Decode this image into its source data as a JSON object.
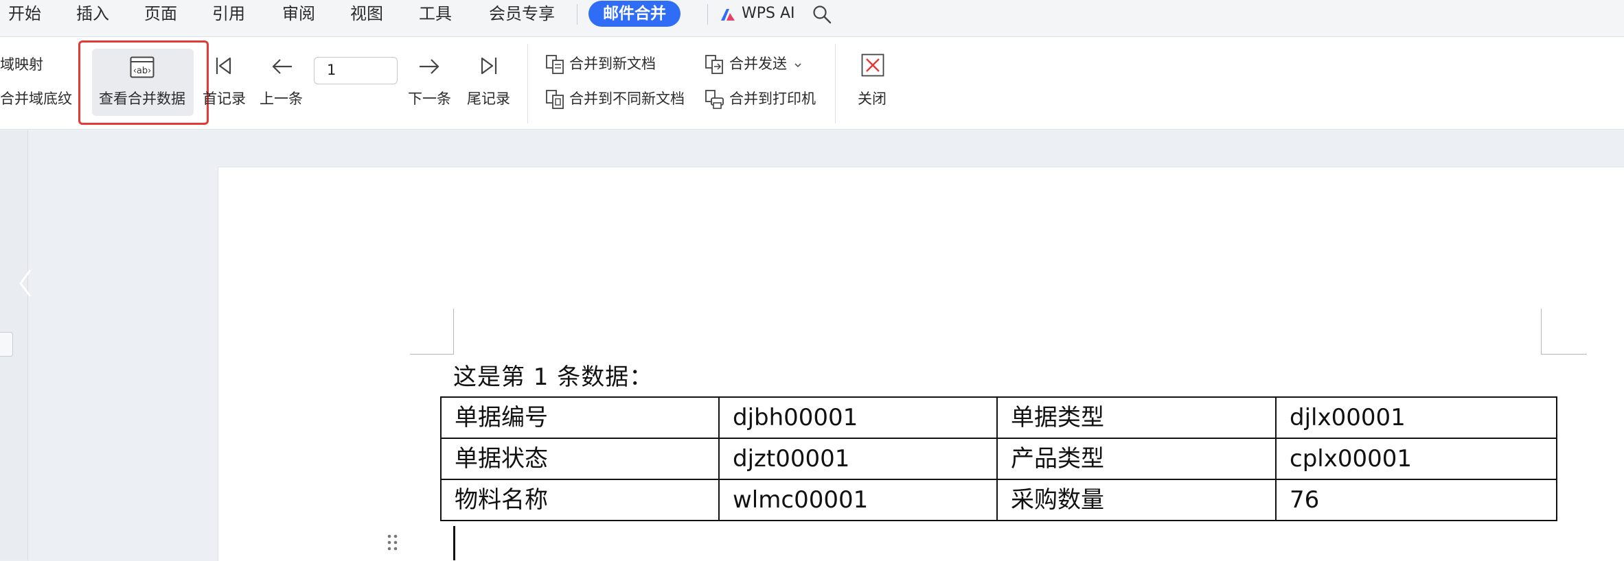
{
  "menu": {
    "items": [
      "开始",
      "插入",
      "页面",
      "引用",
      "审阅",
      "视图",
      "工具",
      "会员专享"
    ],
    "active_tab": "邮件合并",
    "wps_ai": "WPS AI"
  },
  "ribbon": {
    "left_partial_top": "域映射",
    "left_partial_bottom": "合并域底纹",
    "view_merge_data": "查看合并数据",
    "first_record": "首记录",
    "prev_record": "上一条",
    "record_number": "1",
    "next_record": "下一条",
    "last_record": "尾记录",
    "merge_to_new_doc": "合并到新文档",
    "merge_to_separate_docs": "合并到不同新文档",
    "merge_send": "合并发送",
    "merge_to_printer": "合并到打印机",
    "close": "关闭"
  },
  "document": {
    "intro": "这是第 1 条数据：",
    "rows": [
      [
        "单据编号",
        "djbh00001",
        "单据类型",
        "djlx00001"
      ],
      [
        "单据状态",
        "djzt00001",
        "产品类型",
        "cplx00001"
      ],
      [
        "物料名称",
        "wlmc00001",
        "采购数量",
        "76"
      ]
    ]
  },
  "colors": {
    "accent": "#2f6df6",
    "highlight": "#e53935",
    "close_icon": "#e53935"
  },
  "icons": [
    "wps-ai-logo-icon",
    "search-icon",
    "view-merge-data-icon",
    "first-record-icon",
    "prev-arrow-icon",
    "next-arrow-icon",
    "last-record-icon",
    "merge-to-new-doc-icon",
    "merge-to-separate-docs-icon",
    "merge-send-icon",
    "merge-to-printer-icon",
    "close-icon",
    "chevron-left-icon",
    "drag-handle-icon"
  ]
}
